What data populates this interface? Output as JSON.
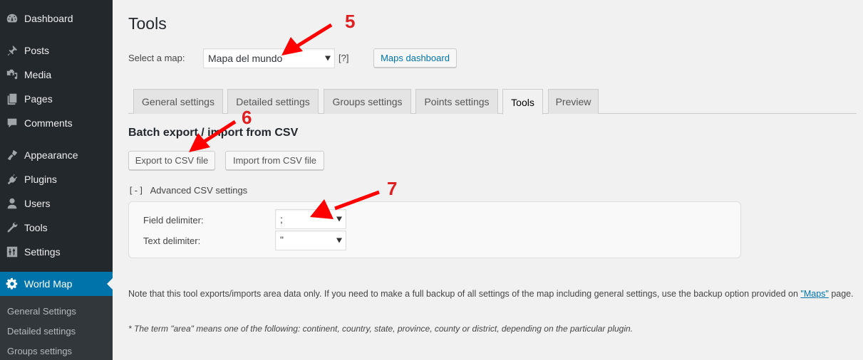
{
  "sidebar": {
    "items": [
      {
        "label": "Dashboard",
        "icon": "dashboard-icon"
      },
      {
        "label": "Posts",
        "icon": "pin-icon"
      },
      {
        "label": "Media",
        "icon": "media-icon"
      },
      {
        "label": "Pages",
        "icon": "pages-icon"
      },
      {
        "label": "Comments",
        "icon": "comment-icon"
      },
      {
        "label": "Appearance",
        "icon": "paintbrush-icon"
      },
      {
        "label": "Plugins",
        "icon": "plugin-icon"
      },
      {
        "label": "Users",
        "icon": "user-icon"
      },
      {
        "label": "Tools",
        "icon": "wrench-icon"
      },
      {
        "label": "Settings",
        "icon": "settings-sliders-icon"
      },
      {
        "label": "World Map",
        "icon": "gear-icon",
        "current": true
      }
    ],
    "submenu": [
      "General Settings",
      "Detailed settings",
      "Groups settings"
    ]
  },
  "header": {
    "title": "Tools",
    "select_map_label": "Select a map:",
    "selected_map": "Mapa del mundo",
    "help_label": "[?]",
    "maps_dashboard_label": "Maps dashboard"
  },
  "tabs": [
    {
      "label": "General settings"
    },
    {
      "label": "Detailed settings"
    },
    {
      "label": "Groups settings"
    },
    {
      "label": "Points settings"
    },
    {
      "label": "Tools",
      "active": true
    },
    {
      "label": "Preview"
    }
  ],
  "batch": {
    "heading": "Batch export / import from CSV",
    "export_label": "Export to CSV file",
    "import_label": "Import from CSV file",
    "advanced_toggle": "[-]",
    "advanced_label": "Advanced CSV settings",
    "field_delimiter_label": "Field delimiter:",
    "field_delimiter_value": ";",
    "text_delimiter_label": "Text delimiter:",
    "text_delimiter_value": "\""
  },
  "notes": {
    "note_before": "Note that this tool exports/imports area data only. If you need to make a full backup of all settings of the map including general settings, use the backup option provided on ",
    "note_link": "\"Maps\"",
    "note_after": " page.",
    "footnote": "* The term \"area\" means one of the following: continent, country, state, province, county or district, depending on the particular plugin."
  },
  "annotations": {
    "step5": "5",
    "step6": "6",
    "step7": "7",
    "color": "#e02020"
  }
}
